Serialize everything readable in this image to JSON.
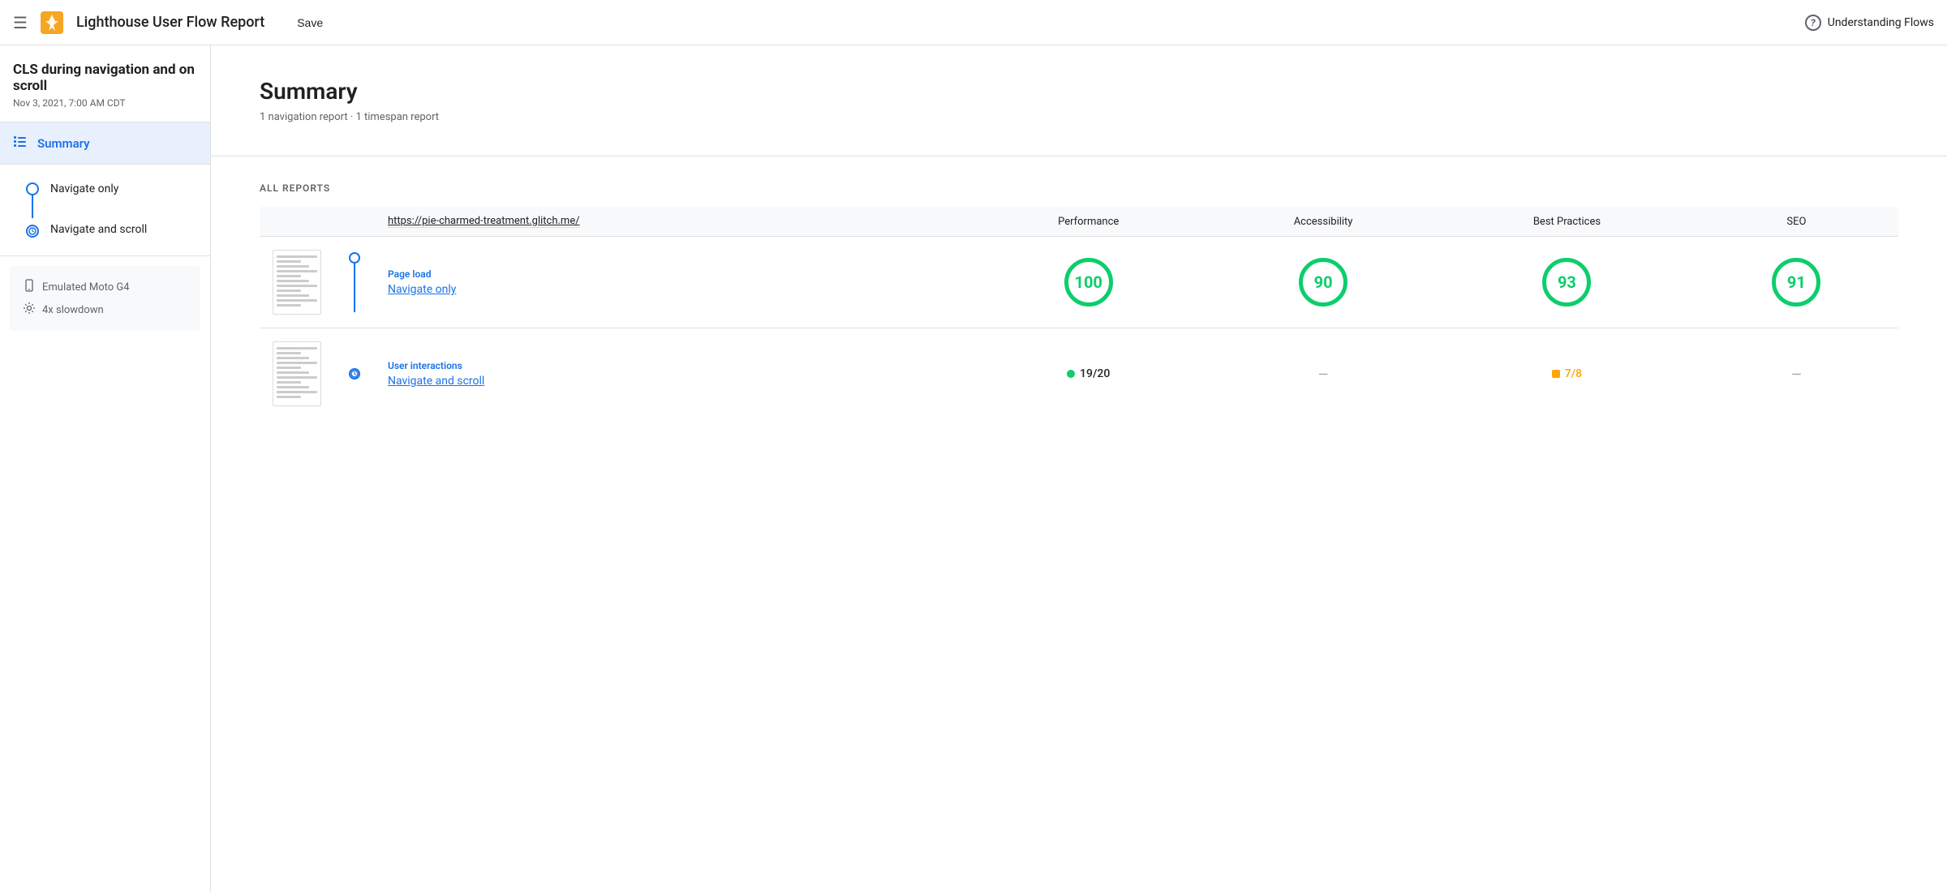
{
  "header": {
    "menu_icon": "☰",
    "logo_alt": "Lighthouse logo",
    "title": "Lighthouse User Flow Report",
    "save_label": "Save",
    "understanding_flows_label": "Understanding Flows",
    "question_char": "?"
  },
  "sidebar": {
    "report_title": "CLS during navigation and on scroll",
    "report_date": "Nov 3, 2021, 7:00 AM CDT",
    "summary_label": "Summary",
    "flow_items": [
      {
        "label": "Navigate only",
        "type": "nav"
      },
      {
        "label": "Navigate and scroll",
        "type": "clock"
      }
    ],
    "device_items": [
      {
        "icon": "🖥",
        "label": "Emulated Moto G4"
      },
      {
        "icon": "⚙",
        "label": "4x slowdown"
      }
    ]
  },
  "main": {
    "summary": {
      "title": "Summary",
      "subtitle": "1 navigation report · 1 timespan report"
    },
    "all_reports": {
      "section_label": "ALL REPORTS",
      "url": "https://pie-charmed-treatment.glitch.me/",
      "columns": [
        "Performance",
        "Accessibility",
        "Best Practices",
        "SEO"
      ],
      "reports": [
        {
          "type": "Page load",
          "name": "Navigate only",
          "scores": [
            {
              "value": "100",
              "color": "green"
            },
            {
              "value": "90",
              "color": "green"
            },
            {
              "value": "93",
              "color": "green"
            },
            {
              "value": "91",
              "color": "green"
            }
          ]
        },
        {
          "type": "User interactions",
          "name": "Navigate and scroll",
          "scores": [
            {
              "type": "partial",
              "dot": "green",
              "text": "19/20"
            },
            {
              "type": "dash"
            },
            {
              "type": "partial",
              "dot": "orange",
              "text": "7/8"
            },
            {
              "type": "dash"
            }
          ]
        }
      ]
    }
  }
}
